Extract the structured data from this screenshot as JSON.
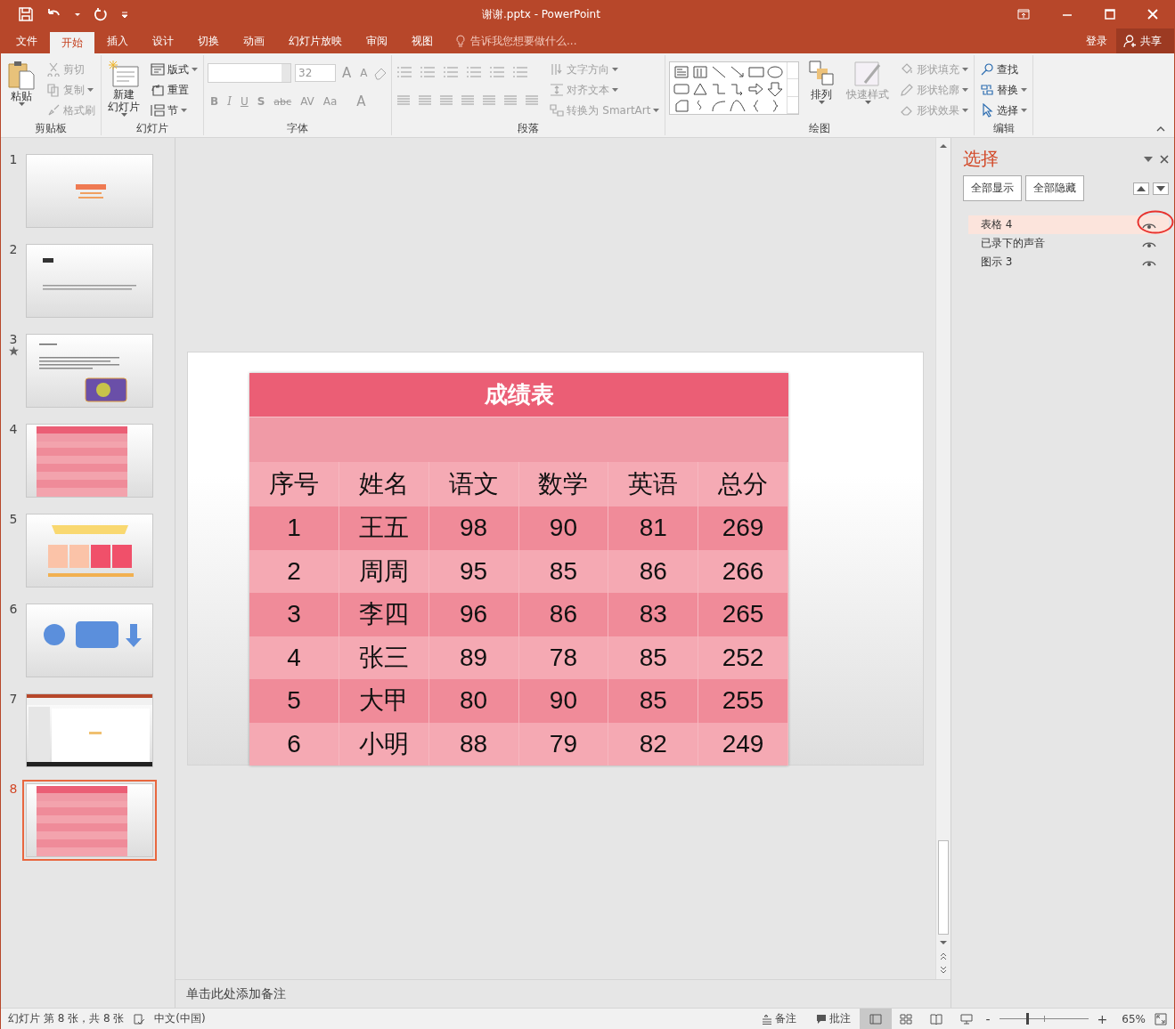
{
  "title_bar": {
    "title": "谢谢.pptx - PowerPoint"
  },
  "ribbon_tabs": [
    {
      "label": "文件",
      "selected": false
    },
    {
      "label": "开始",
      "selected": true
    },
    {
      "label": "插入",
      "selected": false
    },
    {
      "label": "设计",
      "selected": false
    },
    {
      "label": "切换",
      "selected": false
    },
    {
      "label": "动画",
      "selected": false
    },
    {
      "label": "幻灯片放映",
      "selected": false
    },
    {
      "label": "审阅",
      "selected": false
    },
    {
      "label": "视图",
      "selected": false
    }
  ],
  "tell_me": {
    "placeholder": "告诉我您想要做什么..."
  },
  "account": {
    "sign_in": "登录",
    "share": "共享"
  },
  "ribbon_groups": [
    {
      "label": "剪贴板",
      "columns": [
        {
          "kind": "large",
          "lines": [
            "粘贴"
          ],
          "disabled": false,
          "caret": true
        },
        {
          "kind": "stack",
          "items": [
            {
              "label": "剪切",
              "disabled": true,
              "caret": false
            },
            {
              "label": "复制",
              "disabled": true,
              "caret": true
            },
            {
              "label": "格式刷",
              "disabled": true,
              "caret": false
            }
          ]
        }
      ]
    },
    {
      "label": "幻灯片",
      "columns": [
        {
          "kind": "large",
          "lines": [
            "新建",
            "幻灯片"
          ],
          "disabled": false,
          "caret": true
        },
        {
          "kind": "stack",
          "items": [
            {
              "label": "版式",
              "disabled": false,
              "caret": true
            },
            {
              "label": "重置",
              "disabled": false,
              "caret": false
            },
            {
              "label": "节",
              "disabled": false,
              "caret": true
            }
          ]
        }
      ]
    },
    {
      "label": "字体",
      "columns": [
        {
          "kind": "font",
          "size": "32",
          "size_buttons": [
            "A",
            "A"
          ],
          "format_buttons": [
            "B",
            "I",
            "U",
            "S",
            "abc",
            "AV",
            "Aa",
            "A"
          ]
        }
      ]
    },
    {
      "label": "段落",
      "columns": [
        {
          "kind": "paragraph"
        },
        {
          "kind": "stack",
          "items": [
            {
              "label": "文字方向",
              "disabled": true,
              "caret": true
            },
            {
              "label": "对齐文本",
              "disabled": true,
              "caret": true
            },
            {
              "label": "转换为 SmartArt",
              "disabled": true,
              "caret": true
            }
          ]
        }
      ]
    },
    {
      "label": "绘图",
      "columns": [
        {
          "kind": "gallery"
        },
        {
          "kind": "large",
          "lines": [
            "排列"
          ],
          "disabled": false,
          "caret": true
        },
        {
          "kind": "large",
          "lines": [
            "快速样式"
          ],
          "disabled": true,
          "caret": true
        },
        {
          "kind": "stack",
          "items": [
            {
              "label": "形状填充",
              "disabled": true,
              "caret": true
            },
            {
              "label": "形状轮廓",
              "disabled": true,
              "caret": true
            },
            {
              "label": "形状效果",
              "disabled": true,
              "caret": true
            }
          ]
        }
      ]
    },
    {
      "label": "编辑",
      "columns": [
        {
          "kind": "stack",
          "items": [
            {
              "label": "查找",
              "disabled": false,
              "caret": false
            },
            {
              "label": "替换",
              "disabled": false,
              "caret": true
            },
            {
              "label": "选择",
              "disabled": false,
              "caret": true
            }
          ]
        }
      ]
    }
  ],
  "slides": [
    {
      "number": "1",
      "kind": "title",
      "selected": false,
      "animated": false
    },
    {
      "number": "2",
      "kind": "text",
      "selected": false,
      "animated": false
    },
    {
      "number": "3",
      "kind": "picture",
      "selected": false,
      "animated": true
    },
    {
      "number": "4",
      "kind": "table",
      "selected": false,
      "animated": false
    },
    {
      "number": "5",
      "kind": "cards",
      "selected": false,
      "animated": false
    },
    {
      "number": "6",
      "kind": "shapes",
      "selected": false,
      "animated": false
    },
    {
      "number": "7",
      "kind": "screenshot",
      "selected": false,
      "animated": false
    },
    {
      "number": "8",
      "kind": "table",
      "selected": true,
      "animated": false
    }
  ],
  "slide_table": {
    "title": "成绩表",
    "columns": [
      "序号",
      "姓名",
      "语文",
      "数学",
      "英语",
      "总分"
    ],
    "rows": [
      [
        "1",
        "王五",
        "98",
        "90",
        "81",
        "269"
      ],
      [
        "2",
        "周周",
        "95",
        "85",
        "86",
        "266"
      ],
      [
        "3",
        "李四",
        "96",
        "86",
        "83",
        "265"
      ],
      [
        "4",
        "张三",
        "89",
        "78",
        "85",
        "252"
      ],
      [
        "5",
        "大甲",
        "80",
        "90",
        "85",
        "255"
      ],
      [
        "6",
        "小明",
        "88",
        "79",
        "82",
        "249"
      ]
    ]
  },
  "notes": {
    "placeholder": "单击此处添加备注"
  },
  "selection_pane": {
    "title": "选择",
    "buttons": [
      "全部显示",
      "全部隐藏"
    ],
    "items": [
      {
        "label": "表格 4",
        "selected": true,
        "circled": true
      },
      {
        "label": "已录下的声音",
        "selected": false,
        "circled": false
      },
      {
        "label": "图示 3",
        "selected": false,
        "circled": false
      }
    ]
  },
  "status_bar": {
    "slide_info": "幻灯片 第 8 张，共 8 张",
    "language": "中文(中国)",
    "notes": "备注",
    "comments": "批注",
    "views": [
      {
        "selected": true
      },
      {
        "selected": false
      },
      {
        "selected": false
      },
      {
        "selected": false
      }
    ],
    "zoom": {
      "level": 0.31,
      "reading": "65%",
      "zoom_out": "-",
      "zoom_in": "+"
    }
  }
}
